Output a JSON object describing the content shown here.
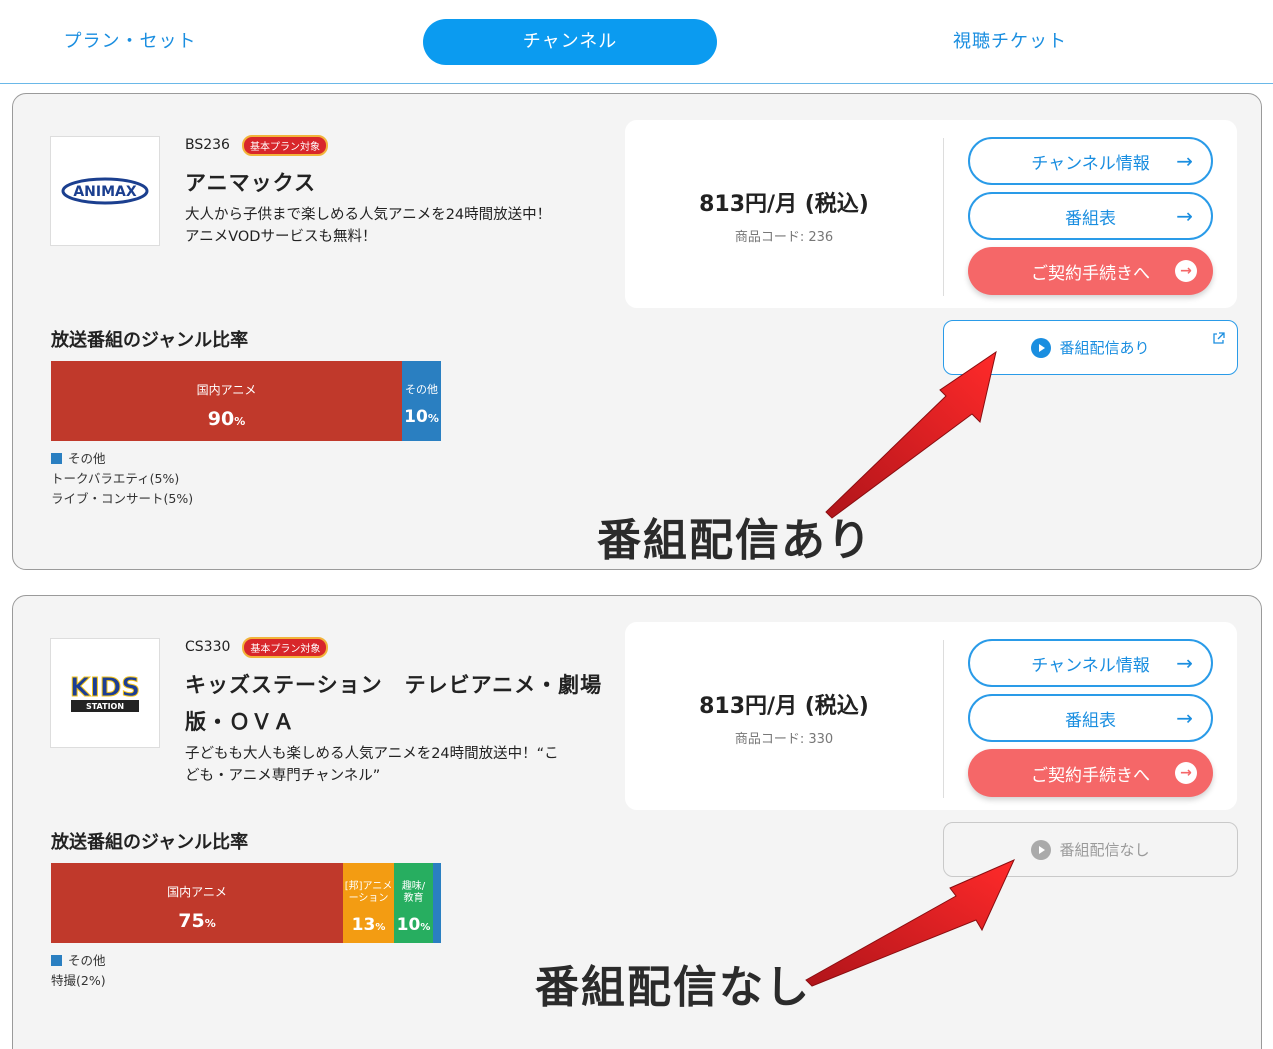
{
  "tabs": [
    {
      "label": "プラン・セット"
    },
    {
      "label": "チャンネル"
    },
    {
      "label": "視聴チケット"
    }
  ],
  "channels": [
    {
      "code": "BS236",
      "badge": "基本プラン対象",
      "name": "アニマックス",
      "desc_lines": [
        "大人から子供まで楽しめる人気アニメを24時間放送中！",
        "アニメVODサービスも無料！"
      ],
      "logo_text": "ANIMAX",
      "price": "813円/月 (税込)",
      "product_code": "商品コード: 236",
      "btn_info": "チャンネル情報",
      "btn_schedule": "番組表",
      "btn_contract": "ご契約手続きへ",
      "stream_label": "番組配信あり",
      "genre_title": "放送番組のジャンル比率",
      "genres": [
        {
          "label": "国内アニメ",
          "pct": "90",
          "unit": "%",
          "color": "#c0392b",
          "share": 90
        },
        {
          "label": "その他",
          "pct": "10",
          "unit": "%",
          "color": "#2a7fc1",
          "share": 10
        }
      ],
      "others_title": "その他",
      "others_lines": [
        "トークバラエティ(5%)",
        "ライブ・コンサート(5%)"
      ],
      "annotation": "番組配信あり"
    },
    {
      "code": "CS330",
      "badge": "基本プラン対象",
      "name_lines": [
        "キッズステーション　テレビアニメ・劇場",
        "版・ＯＶＡ"
      ],
      "desc_lines": [
        "子どもも大人も楽しめる人気アニメを24時間放送中！“こ",
        "ども・アニメ専門チャンネル”"
      ],
      "logo_text": "KIDS",
      "logo_sub": "STATION",
      "price": "813円/月 (税込)",
      "product_code": "商品コード: 330",
      "btn_info": "チャンネル情報",
      "btn_schedule": "番組表",
      "btn_contract": "ご契約手続きへ",
      "stream_label": "番組配信なし",
      "genre_title": "放送番組のジャンル比率",
      "genres": [
        {
          "label": "国内アニメ",
          "pct": "75",
          "unit": "%",
          "color": "#c0392b",
          "share": 75
        },
        {
          "label_lines": [
            "[邦]アニメ",
            "ーション"
          ],
          "pct": "13",
          "unit": "%",
          "color": "#f39c12",
          "share": 13
        },
        {
          "label_lines": [
            "趣味/",
            "教育"
          ],
          "pct": "10",
          "unit": "%",
          "color": "#27ae60",
          "share": 10
        },
        {
          "label": "",
          "pct": "",
          "unit": "",
          "color": "#2a7fc1",
          "share": 2
        }
      ],
      "others_title": "その他",
      "others_lines": [
        "特撮(2%)"
      ],
      "annotation": "番組配信なし"
    }
  ],
  "colors": {
    "accent": "#0b9bf0",
    "contract": "#f56768",
    "arrow": "#e01b22"
  }
}
